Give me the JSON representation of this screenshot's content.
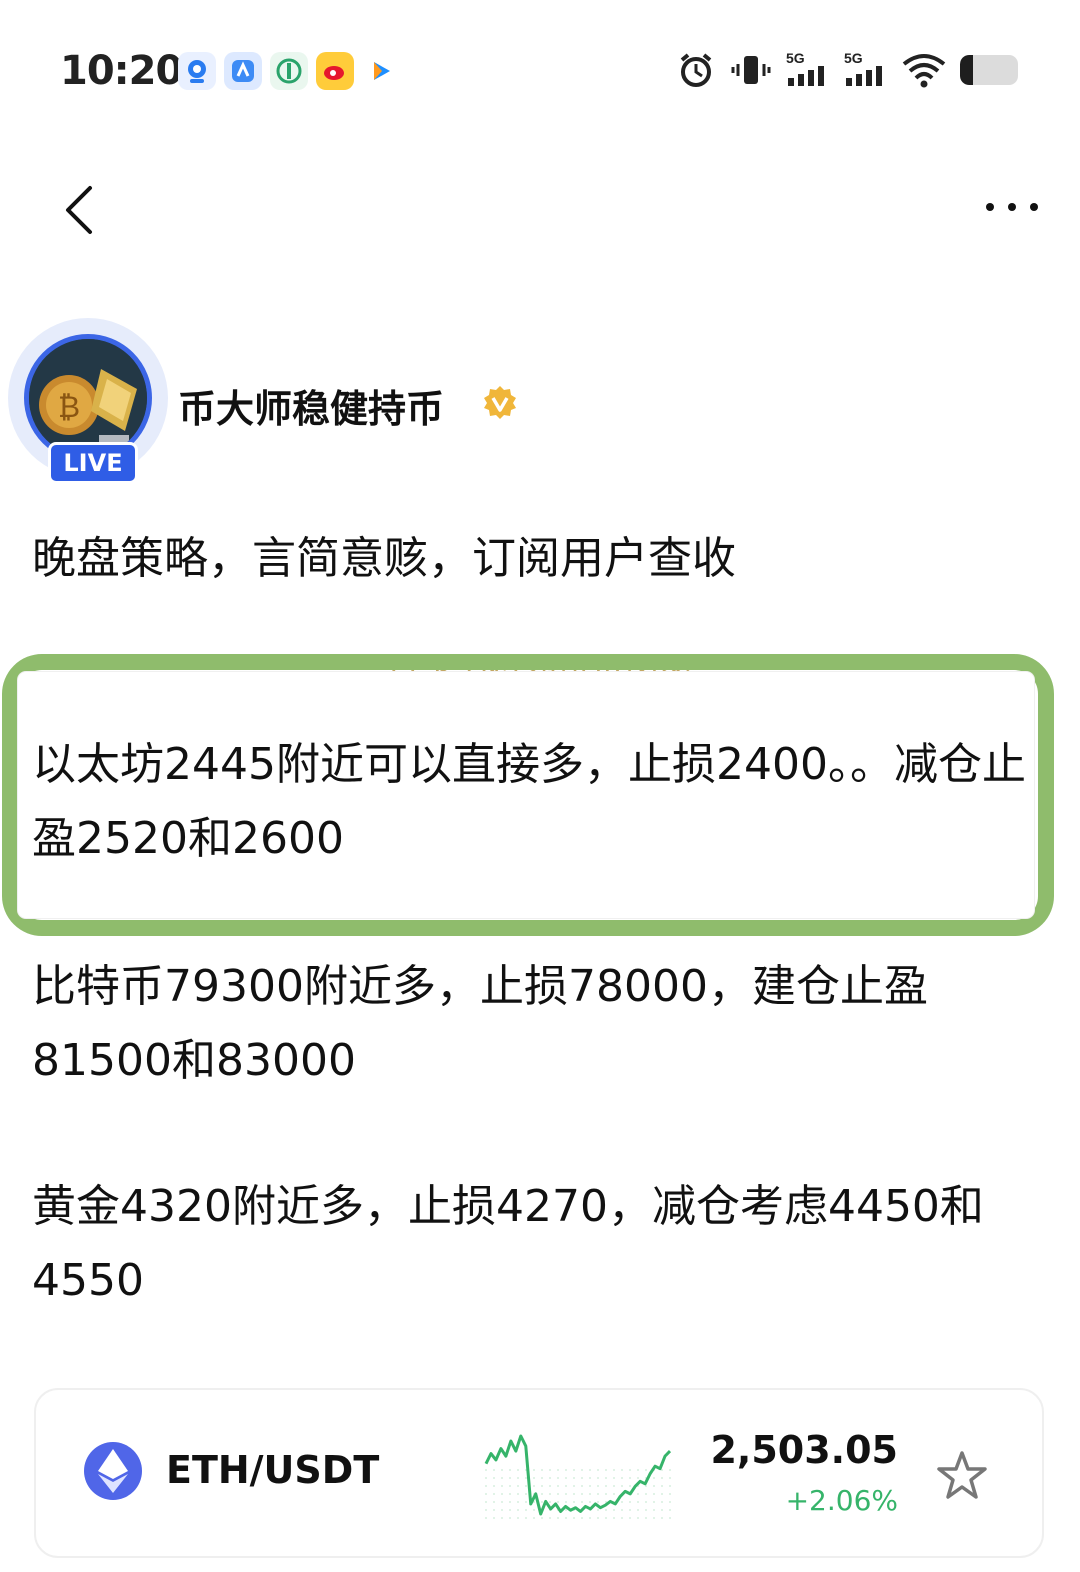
{
  "status_bar": {
    "time": "10:20",
    "app_icons": [
      "app-notification-icon",
      "app-notification-icon",
      "app-notification-icon",
      "weibo-icon",
      "video-app-icon"
    ],
    "network_1": "5G",
    "network_2": "5G",
    "battery_level": 0.22
  },
  "nav": {
    "back_icon": "back-chevron-icon",
    "more_icon": "more-dots-icon"
  },
  "author": {
    "name": "币大师稳健持币",
    "live_label": "LIVE",
    "verified_color": "#f0b63a"
  },
  "post": {
    "intro": "晚盘策略，言简意赅，订阅用户查收",
    "hidden_hint": "以下为付费可见内容",
    "paragraphs": [
      "以太坊2445附近可以直接多，止损2400。。减仓止盈2520和2600",
      "比特币79300附近多，止损78000，建仓止盈81500和83000",
      "黄金4320附近多，止损4270，减仓考虑4450和4550"
    ],
    "highlight_color": "#8fbc6c"
  },
  "ticker": {
    "pair": "ETH/USDT",
    "price": "2,503.05",
    "change": "+2.06%",
    "change_color": "#36b46a",
    "sparkline": [
      52,
      60,
      55,
      64,
      58,
      70,
      62,
      74,
      66,
      20,
      28,
      12,
      22,
      16,
      20,
      14,
      18,
      15,
      17,
      14,
      18,
      16,
      20,
      17,
      19,
      22,
      20,
      26,
      30,
      28,
      34,
      38,
      36,
      44,
      50,
      48,
      58,
      62
    ]
  }
}
